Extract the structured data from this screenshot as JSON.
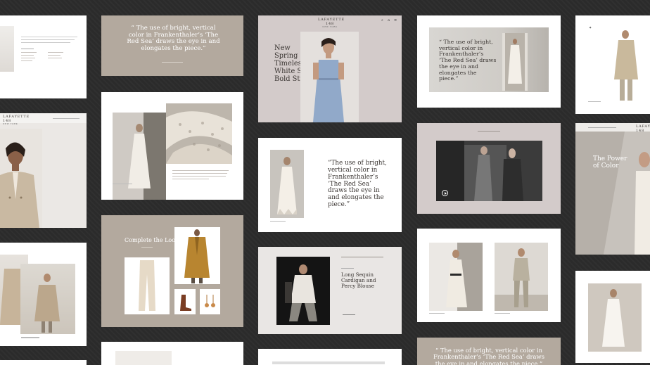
{
  "brand": {
    "name": "LAFAYETTE 148",
    "tagline": "NEW YORK"
  },
  "quotes": {
    "frankenthaler": "“ The use of bright, vertical color in Frankenthaler’s ‘The Red Sea’ draws the eye in and elongates the piece.”",
    "frankenthaler_alt": "“The use of bright, vertical color in Frankenthaler’s ‘The Red Sea’ draws the eye in and elongates the piece.”",
    "frankenthaler_bottom": "“ The use of bright, vertical color in Frankenthaler’s ‘The Red Sea’ draws the eye in and elongates the piece.”"
  },
  "hero_menu": {
    "items": [
      "New",
      "Spring Looks",
      "Timeless Essentials",
      "White Shirts",
      "Bold Stripes"
    ]
  },
  "complete_the_look": {
    "title": "Complete the Look"
  },
  "sequin_card": {
    "title": "Long Sequin Cardigan and Percy Blouse"
  },
  "power_card": {
    "title": "The Power of Color"
  },
  "colors": {
    "background": "#2b2b2b",
    "taupe": "#b3a99e",
    "mauve": "#d3cbca",
    "white": "#ffffff"
  },
  "icons": [
    "search-icon",
    "home-icon",
    "menu-icon",
    "play-icon"
  ]
}
